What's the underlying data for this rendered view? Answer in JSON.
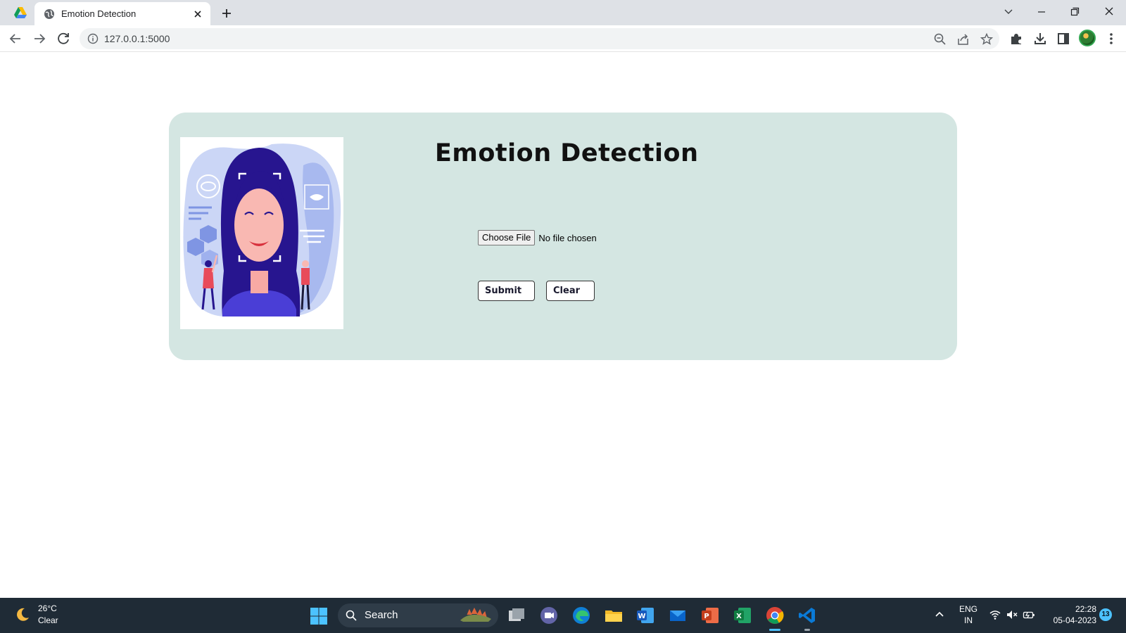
{
  "browser": {
    "tab_title": "Emotion Detection",
    "url": "127.0.0.1:5000"
  },
  "page": {
    "title": "Emotion Detection",
    "file_input": {
      "button_label": "Choose File",
      "status": "No file chosen"
    },
    "submit_label": "Submit",
    "clear_label": "Clear"
  },
  "taskbar": {
    "weather_temp": "26°C",
    "weather_condition": "Clear",
    "search_label": "Search",
    "lang_line1": "ENG",
    "lang_line2": "IN",
    "time": "22:28",
    "date": "05-04-2023",
    "notification_count": "13",
    "apps": [
      "windows-start",
      "search",
      "task-view",
      "teams-chat",
      "edge",
      "file-explorer",
      "word",
      "mail",
      "powerpoint",
      "excel",
      "chrome",
      "vscode"
    ]
  },
  "colors": {
    "card_background": "#d4e6e2",
    "tab_bar": "#dee1e6",
    "taskbar": "#1f2b36"
  }
}
